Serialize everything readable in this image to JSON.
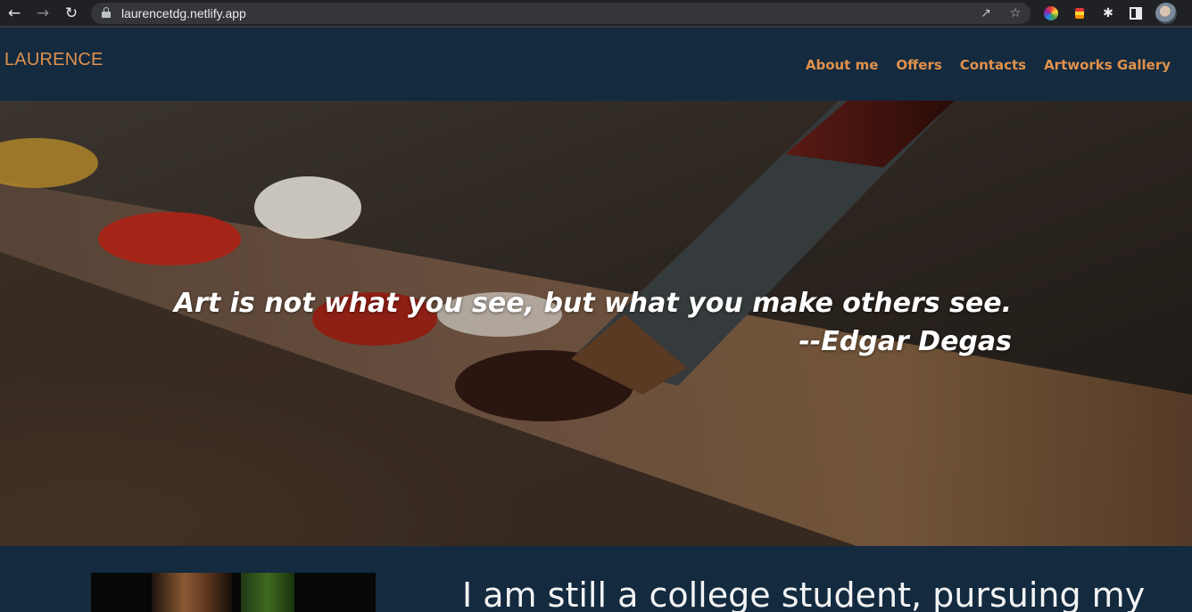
{
  "browser": {
    "url": "laurencetdg.netlify.app",
    "icons": [
      "back-icon",
      "forward-icon",
      "reload-icon",
      "lock-icon",
      "share-icon",
      "star-icon",
      "color-picker-extension-icon",
      "extension-icon",
      "puzzle-icon",
      "side-panel-icon",
      "profile-avatar"
    ]
  },
  "header": {
    "brand": "LAURENCE",
    "menu": [
      "About me",
      "Offers",
      "Contacts",
      "Artworks Gallery"
    ]
  },
  "hero": {
    "quote": "Art is not what you see, but what you make others see.",
    "author": "--Edgar Degas"
  },
  "intro": {
    "text": "I am still a college student, pursuing my"
  },
  "colors": {
    "accent": "#e1914c",
    "header_bg": "#132a3f",
    "chrome_bg": "#202124"
  }
}
